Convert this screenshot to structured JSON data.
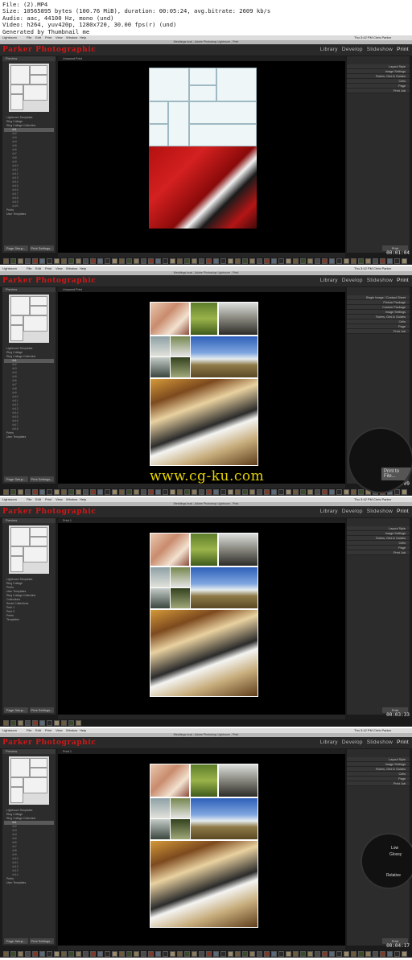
{
  "header": {
    "file": "File: (2).MP4",
    "size": "Size: 10565895 bytes (100.76 MiB), duration: 00:05:24, avg.bitrate: 2609 kb/s",
    "audio": "Audio: aac, 44100 Hz, mono (und)",
    "video": "Video: h264, yuv420p, 1280x720, 30.00 fps(r) (und)",
    "generator": "Generated by Thumbnail me"
  },
  "app": {
    "brand": "Parker Photographic",
    "modules": [
      "Library",
      "Develop",
      "Slideshow",
      "Print"
    ],
    "window_title": "Weddings.lrcat - Adobe Photoshop Lightroom - Print",
    "menu": [
      "Lightroom",
      "File",
      "Edit",
      "Print",
      "View",
      "Window",
      "Help"
    ],
    "clock": "Thu 3:42 PM   Chris Parker",
    "left_panel_title": "Preview",
    "template_browser": "Template Browser",
    "page_setup": "Page Setup...",
    "print_settings": "Print Settings...",
    "print_btn": "Print",
    "print_to_file": "Print to File...",
    "print_job": "Print Job"
  },
  "frames": [
    {
      "timestamp": "00:01:04",
      "canvas_title": "Unsaved Print",
      "right_items": [
        "Layout Style",
        "Image Settings",
        "Rulers, Grid & Guides",
        "Cells",
        "Page",
        "Print Job"
      ],
      "tree": [
        "Lightroom Templates",
        "Ring Collage",
        "Ring Collage Collection",
        "4x1",
        "4x2",
        "4x3",
        "4x4",
        "4x5",
        "4x6",
        "4x7",
        "4x8",
        "4x9",
        "4x10",
        "4x11",
        "4x12",
        "4x13",
        "4x14",
        "4x15",
        "4x16",
        "4x17",
        "4x18",
        "4x19",
        "4x20",
        "Prints",
        "User Templates"
      ]
    },
    {
      "timestamp": "00:02:09",
      "canvas_title": "Unsaved Print",
      "right_items": [
        "Single Image / Contact Sheet",
        "Picture Package",
        "Custom Package",
        "Image Settings",
        "Rulers, Grid & Guides",
        "Cells",
        "Page",
        "Print Job"
      ],
      "tree": [
        "Lightroom Templates",
        "Ring Collage",
        "Ring Collage Collection",
        "4x1",
        "4x2",
        "4x3",
        "4x4",
        "4x5",
        "4x6",
        "4x7",
        "4x8",
        "4x9",
        "4x10",
        "4x11",
        "4x12",
        "4x13",
        "4x14",
        "4x15",
        "4x16",
        "4x17",
        "4x18",
        "Prints",
        "User Templates"
      ]
    },
    {
      "timestamp": "00:03:33",
      "canvas_title": "Print 1",
      "right_items": [
        "Layout Style",
        "Image Settings",
        "Rulers, Grid & Guides",
        "Cells",
        "Page",
        "Print Job"
      ],
      "tree": [
        "Lightroom Templates",
        "Ring Collage",
        "Prints",
        "User Templates",
        "Ring Collage Collection",
        "Collections",
        "Smart Collections",
        "Print 1",
        "Print 2",
        "Prints",
        "Templates"
      ]
    },
    {
      "timestamp": "00:04:17",
      "canvas_title": "Print 1",
      "right_items": [
        "Layout Style",
        "Image Settings",
        "Rulers, Grid & Guides",
        "Cells",
        "Page",
        "Print Job"
      ],
      "tree": [
        "Lightroom Templates",
        "Ring Collage",
        "Ring Collage Collection",
        "4x1",
        "4x2",
        "4x3",
        "4x4",
        "4x5",
        "4x6",
        "4x7",
        "4x8",
        "4x9",
        "4x10",
        "4x11",
        "4x12",
        "4x13",
        "4x14",
        "Prints",
        "User Templates"
      ]
    }
  ],
  "watermark": "www.cg-ku.com",
  "lens_frame2": "Print to File...",
  "lens_frame4": {
    "label1": "Low",
    "label2": "Glossy",
    "label3": "Relative"
  },
  "colors": {
    "brand_red": "#d11717",
    "watermark": "#e6d300",
    "panel": "#2c2c2c",
    "canvas": "#000000"
  }
}
